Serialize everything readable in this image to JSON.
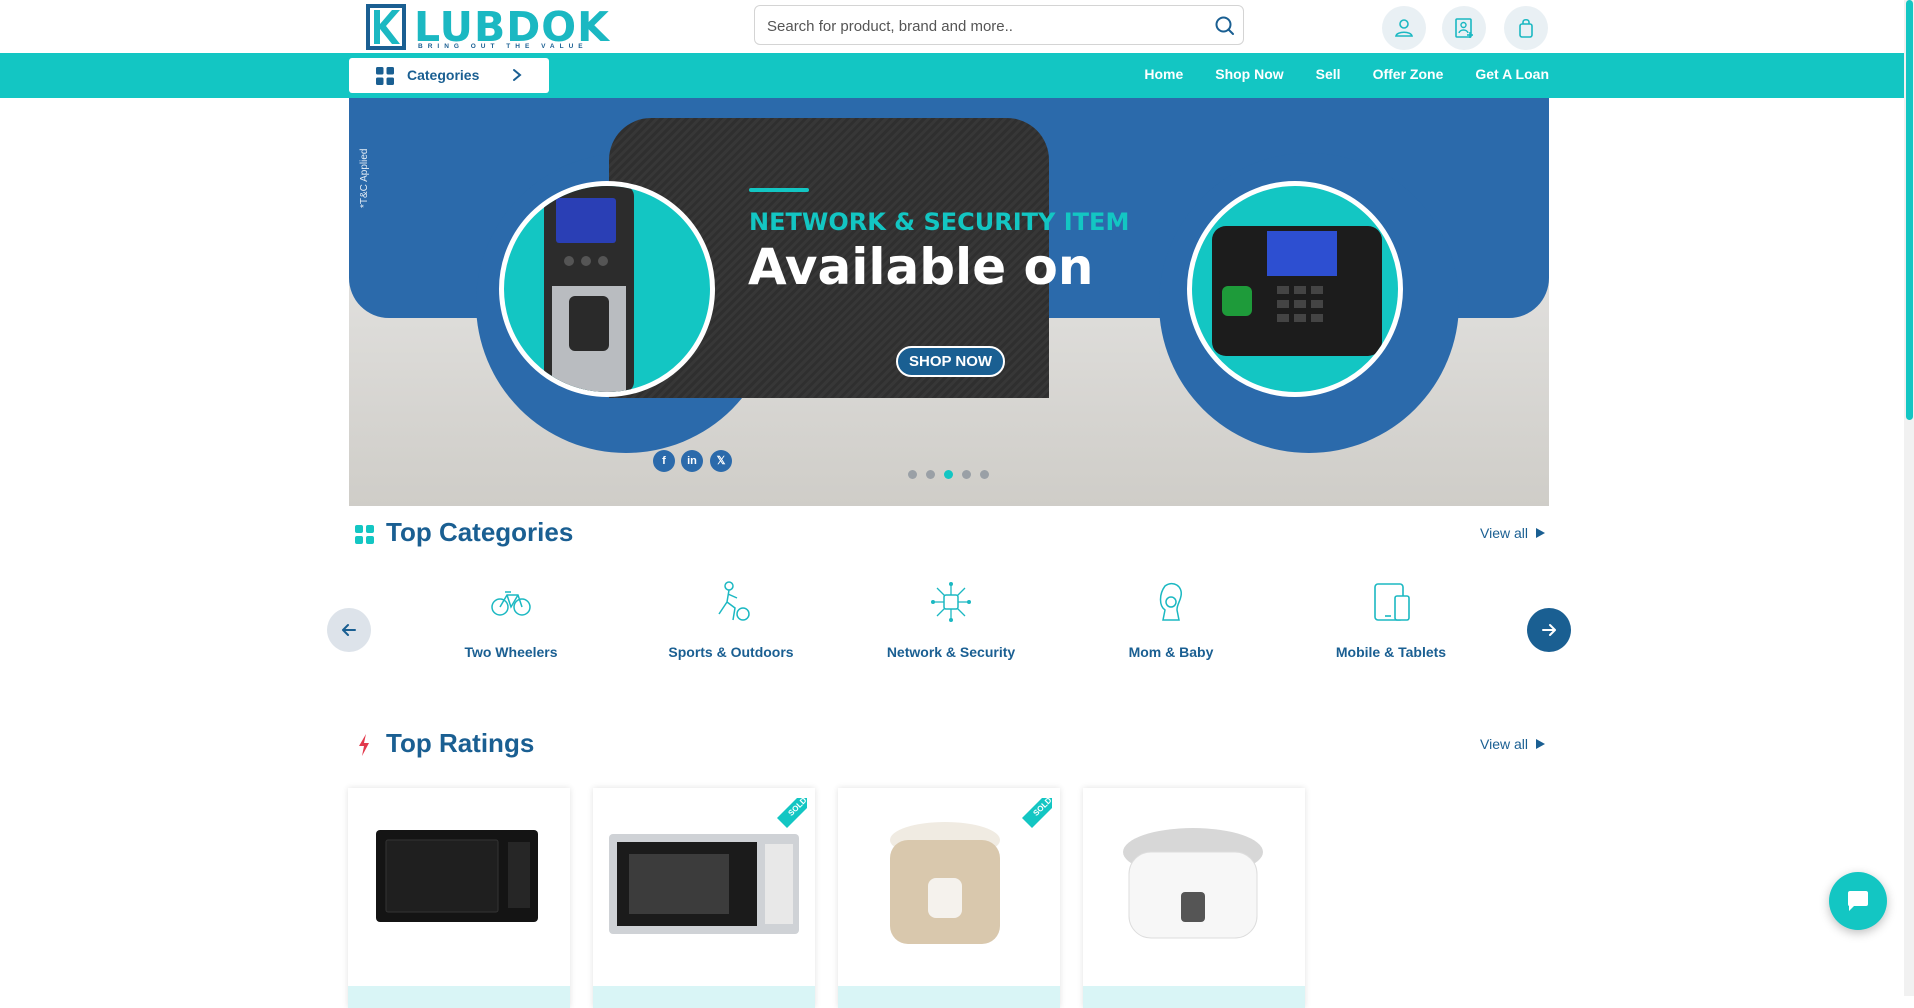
{
  "brand": {
    "name": "LUBDOK",
    "tagline": "BRING OUT THE VALUE",
    "color_primary": "#1a5f92",
    "color_accent": "#13c6c3"
  },
  "search": {
    "placeholder": "Search for product, brand and more.."
  },
  "header_icons": [
    "user-icon",
    "add-user-icon",
    "shopping-bag-icon"
  ],
  "categories_button": {
    "label": "Categories"
  },
  "nav": {
    "items": [
      {
        "label": "Home"
      },
      {
        "label": "Shop Now"
      },
      {
        "label": "Sell"
      },
      {
        "label": "Offer Zone"
      },
      {
        "label": "Get A Loan"
      }
    ]
  },
  "hero": {
    "tc": "*T&C Applied",
    "subtitle": "NETWORK & SECURITY ITEM",
    "title": "Available on",
    "cta": "SHOP NOW",
    "slides_total": 5,
    "active_slide": 3,
    "social": [
      {
        "icon": "facebook-icon",
        "glyph": "f"
      },
      {
        "icon": "linkedin-icon",
        "glyph": "in"
      },
      {
        "icon": "x-icon",
        "glyph": "𝕏"
      }
    ]
  },
  "top_categories": {
    "title": "Top Categories",
    "view_all": "View all",
    "items": [
      {
        "label": "Two Wheelers",
        "icon": "bicycle-icon"
      },
      {
        "label": "Sports & Outdoors",
        "icon": "sports-icon"
      },
      {
        "label": "Network & Security",
        "icon": "network-icon"
      },
      {
        "label": "Mom & Baby",
        "icon": "mom-baby-icon"
      },
      {
        "label": "Mobile & Tablets",
        "icon": "mobile-tablet-icon"
      }
    ]
  },
  "top_ratings": {
    "title": "Top Ratings",
    "view_all": "View all",
    "products": [
      {
        "image": "microwave-oven",
        "sold": false
      },
      {
        "image": "panasonic-microwave",
        "sold": true,
        "badge": "SOLD"
      },
      {
        "image": "rice-cooker-gold",
        "sold": true,
        "badge": "SOLD"
      },
      {
        "image": "rice-cooker-white",
        "sold": false
      }
    ]
  }
}
